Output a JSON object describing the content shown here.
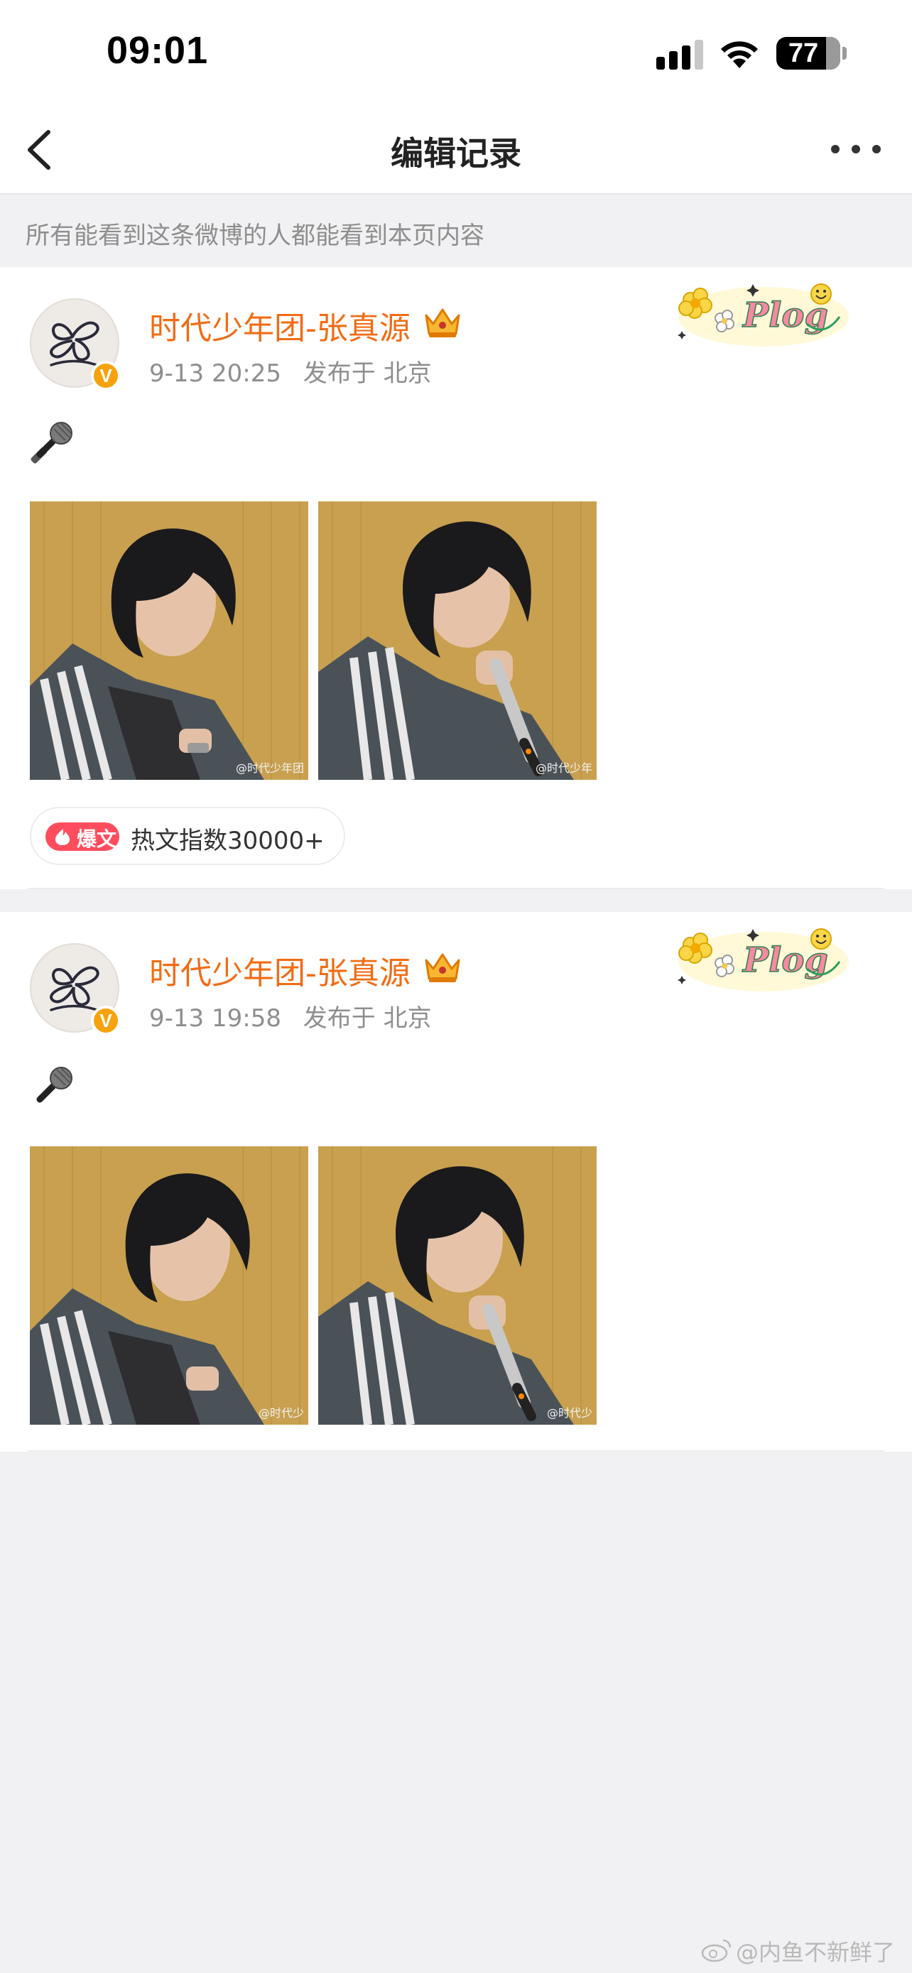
{
  "status_bar": {
    "time": "09:01",
    "battery": "77",
    "icons": [
      "cellular-signal-icon",
      "wifi-icon",
      "battery-icon"
    ]
  },
  "nav": {
    "title": "编辑记录",
    "back_icon": "chevron-left-icon",
    "more_icon": "more-dots-icon"
  },
  "notice": "所有能看到这条微博的人都能看到本页内容",
  "posts": [
    {
      "username": "时代少年团-张真源",
      "time": "9-13 20:25",
      "location": "发布于 北京",
      "content_icon": "microphone-icon",
      "photo_watermarks": [
        "@时代少年团",
        "@时代少年"
      ],
      "hot_badge": {
        "tag": "爆文",
        "text": "热文指数30000+"
      }
    },
    {
      "username": "时代少年团-张真源",
      "time": "9-13 19:58",
      "location": "发布于 北京",
      "content_icon": "microphone-icon",
      "photo_watermarks": [
        "@时代少",
        "@时代少"
      ]
    }
  ],
  "decoration_text": "Plog",
  "footer_watermark": "@内鱼不新鲜了",
  "colors": {
    "username": "#f26c14",
    "verified": "#f7a20d",
    "hot_pill": "#ff4d5e",
    "meta": "#8e8e8e",
    "background": "#f1f1f3"
  }
}
